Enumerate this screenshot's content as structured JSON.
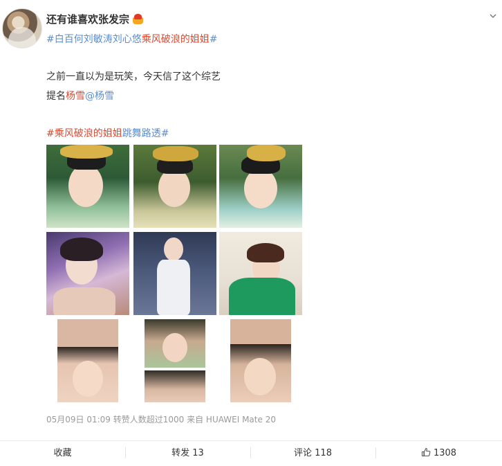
{
  "post": {
    "username": "还有谁喜欢张发宗",
    "topic_line": {
      "part1": "#白百何刘敏涛刘心悠",
      "part2": "乘风破浪的姐姐",
      "part3": "#"
    },
    "body_line1": "之前一直以为是玩笑，今天信了这个综艺",
    "body_line2": {
      "prefix": "提名",
      "name": "杨雪",
      "mention": "@杨雪"
    },
    "hashtag_line": {
      "part1": "#乘风破浪的姐姐",
      "part2": "跳舞路透#"
    },
    "meta": "05月09日 01:09 转赞人数超过1000  来自 HUAWEI Mate 20"
  },
  "actions": {
    "favorite": "收藏",
    "repost": "转发 13",
    "comment": "评论 118",
    "like": "1308"
  },
  "colors": {
    "link_blue": "#5a8ed1",
    "link_red": "#e0492f",
    "meta_gray": "#999999"
  },
  "icons": [
    "crown-icon",
    "chevron-down-icon",
    "thumbs-up-icon"
  ]
}
